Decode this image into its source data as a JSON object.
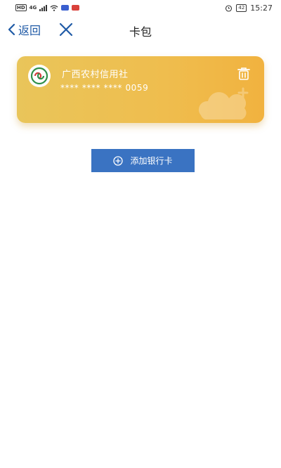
{
  "status_bar": {
    "network_badge": "HD",
    "network_type": "4G",
    "battery": "42",
    "time": "15:27"
  },
  "nav": {
    "back_label": "返回",
    "title": "卡包"
  },
  "card": {
    "bank_name": "广西农村信用社",
    "card_number": "**** **** **** 0059"
  },
  "actions": {
    "add_card_label": "添加银行卡"
  },
  "icons": {
    "back": "chevron-left-icon",
    "close": "close-icon",
    "delete": "trash-icon",
    "add": "plus-circle-icon",
    "bank_logo": "bank-logo-icon"
  },
  "colors": {
    "accent": "#1f5aa6",
    "button": "#3a73c2",
    "card_start": "#e9c55a",
    "card_end": "#f1b23f"
  }
}
